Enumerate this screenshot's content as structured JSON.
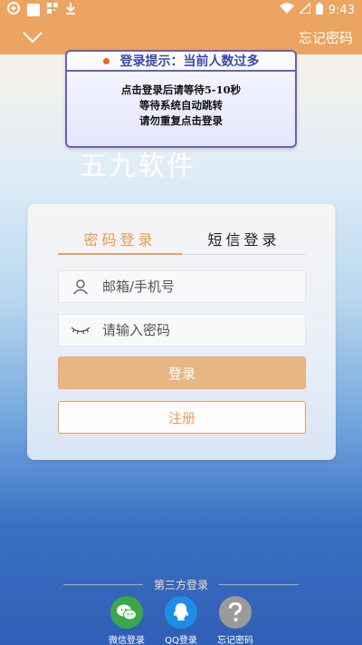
{
  "status_bar": {
    "time": "9:43"
  },
  "nav": {
    "forgot_label": "忘记密码"
  },
  "notice": {
    "title": "登录提示：当前人数过多",
    "lines": [
      "点击登录后请等待5-10秒",
      "等待系统自动跳转",
      "请勿重复点击登录"
    ]
  },
  "watermark": "五九软件",
  "tabs": [
    {
      "label": "密码登录"
    },
    {
      "label": "短信登录"
    }
  ],
  "form": {
    "username_placeholder": "邮箱/手机号",
    "password_placeholder": "请输入密码",
    "login_label": "登录",
    "register_label": "注册"
  },
  "third_party": {
    "title": "第三方登录",
    "items": [
      {
        "label": "微信登录",
        "icon": "wechat-icon",
        "color": "#3aa84a"
      },
      {
        "label": "QQ登录",
        "icon": "qq-icon",
        "color": "#1d8ee6"
      },
      {
        "label": "忘记密码",
        "icon": "question-icon",
        "color": "#9a9a9a"
      }
    ]
  },
  "colors": {
    "accent": "#eba461",
    "button": "#e8b685",
    "register_border": "#e8a060"
  }
}
